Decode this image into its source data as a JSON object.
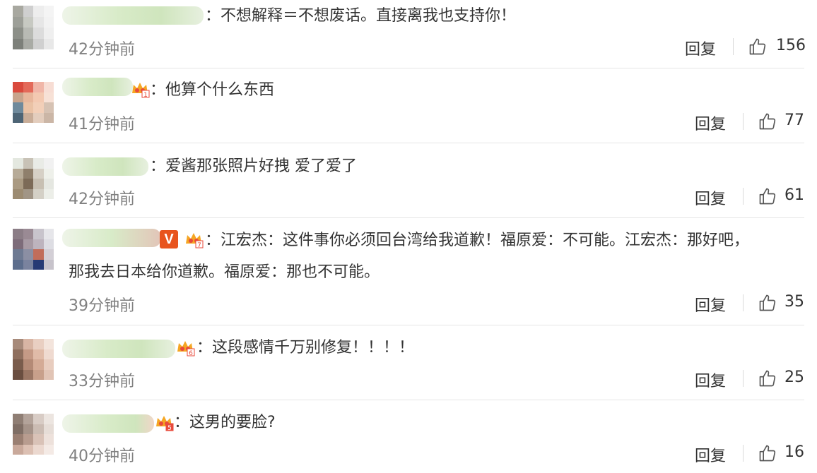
{
  "ui": {
    "reply_label": "回复",
    "separator": "："
  },
  "comments": [
    {
      "text": "不想解释＝不想废话。直接离我也支持你！",
      "time": "42分钟前",
      "likes": "156"
    },
    {
      "text": "他算个什么东西",
      "time": "41分钟前",
      "likes": "77"
    },
    {
      "text": "爱酱那张照片好拽 爱了爱了",
      "time": "42分钟前",
      "likes": "61"
    },
    {
      "text": "江宏杰：这件事你必须回台湾给我道歉！福原爱：不可能。江宏杰：那好吧，",
      "text_line2": "那我去日本给你道歉。福原爱：那也不可能。",
      "time": "39分钟前",
      "likes": "35",
      "badge_v": "V"
    },
    {
      "text": "这段感情千万别修复！！！！",
      "time": "33分钟前",
      "likes": "25"
    },
    {
      "text": "这男的要脸?",
      "time": "40分钟前",
      "likes": "16"
    }
  ],
  "icons": {
    "like": "thumbs-up-icon",
    "member_badge": "crown-icon",
    "verified_badge": "v-badge"
  },
  "colors": {
    "meta_text": "#808080",
    "divider": "#e6e6e6",
    "badge_v": "#e8541e",
    "crown": "#f5a623"
  }
}
